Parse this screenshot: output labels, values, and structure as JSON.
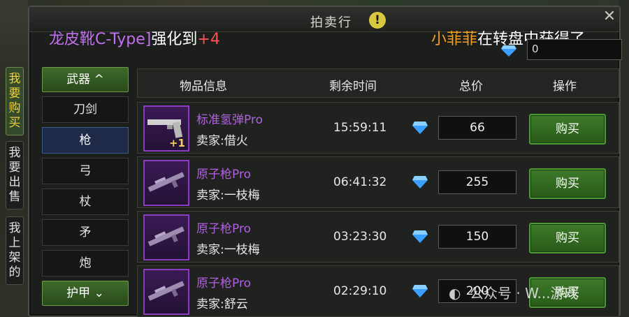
{
  "window": {
    "title": "拍卖行",
    "warn_glyph": "!",
    "close_glyph": "✕"
  },
  "announcement": {
    "left": {
      "item": "龙皮靴C-Type]",
      "action": "强化到",
      "level": "+4"
    },
    "right": {
      "player": "小菲菲",
      "text": "在转盘中获得了"
    }
  },
  "currency": {
    "value": "0",
    "icon": "diamond-icon"
  },
  "side_tabs": [
    {
      "label": "我要购买",
      "active": true
    },
    {
      "label": "我要出售",
      "active": false
    },
    {
      "label": "我上架的",
      "active": false
    }
  ],
  "categories": {
    "group1": {
      "label": "武器",
      "chevron": "^"
    },
    "items": [
      {
        "label": "刀剑",
        "selected": false
      },
      {
        "label": "枪",
        "selected": true
      },
      {
        "label": "弓",
        "selected": false
      },
      {
        "label": "杖",
        "selected": false
      },
      {
        "label": "矛",
        "selected": false
      },
      {
        "label": "炮",
        "selected": false
      }
    ],
    "group2": {
      "label": "护甲",
      "chevron": "⌄"
    }
  },
  "table": {
    "headers": {
      "info": "物品信息",
      "time": "剩余时间",
      "price": "总价",
      "action": "操作"
    },
    "rows": [
      {
        "name": "标准氢弹Pro",
        "seller": "卖家:借火",
        "time": "15:59:11",
        "price": "66",
        "buy": "购买",
        "badge": "+1"
      },
      {
        "name": "原子枪Pro",
        "seller": "卖家:一枝梅",
        "time": "06:41:32",
        "price": "255",
        "buy": "购买"
      },
      {
        "name": "原子枪Pro",
        "seller": "卖家:一枝梅",
        "time": "03:23:30",
        "price": "150",
        "buy": "购买"
      },
      {
        "name": "原子枪Pro",
        "seller": "卖家:舒云",
        "time": "02:29:10",
        "price": "200",
        "buy": "购买"
      }
    ]
  },
  "watermark": "公众号 · W...游戏"
}
